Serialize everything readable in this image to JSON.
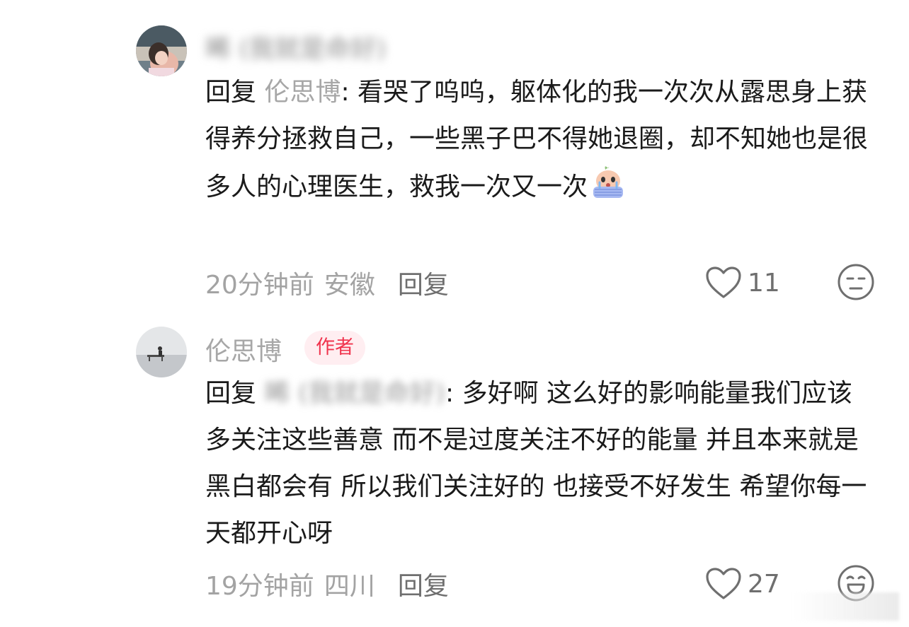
{
  "comments": [
    {
      "username": "晞 (我就是命好)",
      "is_author": false,
      "reply_word": "回复",
      "reply_target": "伦思博",
      "text": ": 看哭了呜呜，躯体化的我一次次从露思身上获得养分拯救自己，一些黑子巴不得她退圈，却不知她也是很多人的心理医生，救我一次又一次",
      "emoji": "crying-face-sticker",
      "time": "20分钟前",
      "location": "安徽",
      "reply_label": "回复",
      "likes": "11",
      "reaction_icon": "neutral-face-icon"
    },
    {
      "username": "伦思博",
      "is_author": true,
      "author_badge": "作者",
      "reply_word": "回复",
      "reply_target": "晞 (我就是命好)",
      "text": ": 多好啊 这么好的影响能量我们应该多关注这些善意 而不是过度关注不好的能量 并且本来就是黑白都会有 所以我们关注好的 也接受不好发生 希望你每一天都开心呀",
      "time": "19分钟前",
      "location": "四川",
      "reply_label": "回复",
      "likes": "27",
      "reaction_icon": "grinning-face-icon"
    }
  ],
  "colors": {
    "text": "#1a1a1a",
    "muted": "#a7a7a7",
    "badge_bg": "#ffeef1",
    "badge_text": "#f0344e"
  }
}
